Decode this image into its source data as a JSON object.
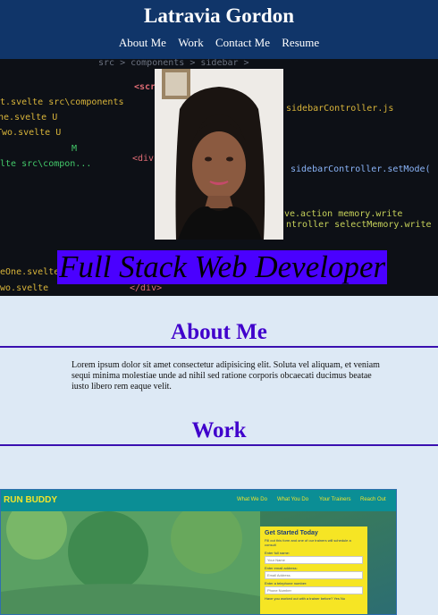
{
  "header": {
    "name": "Latravia Gordon",
    "nav": [
      "About Me",
      "Work",
      "Contact Me",
      "Resume"
    ]
  },
  "hero": {
    "tagline": "Full Stack Web Developer",
    "code_lines": [
      {
        "text": "src > components > sidebar >",
        "color": "#6b7280"
      },
      {
        "text": "<scri",
        "color": "#e06c75"
      },
      {
        "text": "ht.svelte  src\\components",
        "color": "#d8b43a"
      },
      {
        "text": "ne.svelte   U",
        "color": "#d8b43a"
      },
      {
        "text": "Two.svelte  U",
        "color": "#d8b43a"
      },
      {
        "text": "M",
        "color": "#43c96a"
      },
      {
        "text": "elte  src\\compon...",
        "color": "#43c96a"
      },
      {
        "text": "sidebarController.js",
        "color": "#d8b43a"
      },
      {
        "text": "sidebarController.setMode(",
        "color": "#8ab4f8"
      },
      {
        "text": "ve.action memory.write",
        "color": "#c6d15a"
      },
      {
        "text": "ntroller selectMemory.write",
        "color": "#c6d15a"
      },
      {
        "text": "<div",
        "color": "#e06c75"
      },
      {
        "text": "</div>",
        "color": "#e06c75"
      },
      {
        "text": "neOne.svelte",
        "color": "#d8b43a"
      },
      {
        "text": "Two.svelte",
        "color": "#d8b43a"
      }
    ]
  },
  "about": {
    "title": "About Me",
    "text": "Lorem ipsum dolor sit amet consectetur adipisicing elit. Soluta vel aliquam, et veniam sequi minima molestiae unde ad nihil sed ratione corporis obcaecati ducimus beatae iusto libero rem eaque velit."
  },
  "work": {
    "title": "Work",
    "project": {
      "brand": "RUN BUDDY",
      "nav": [
        "What We Do",
        "What You Do",
        "Your Trainers",
        "Reach Out"
      ],
      "form_title": "Get Started Today",
      "form_subtitle": "Fill out this form and one of our trainers will schedule a consult",
      "fields": [
        {
          "label": "Enter full name:",
          "placeholder": "Your Name"
        },
        {
          "label": "Enter email address:",
          "placeholder": "Email Address"
        },
        {
          "label": "Enter a telephone number:",
          "placeholder": "Phone Number"
        }
      ],
      "question": "Have you worked out with a trainer before?",
      "yes": "Yes",
      "no": "No"
    }
  },
  "colors": {
    "header_bg": "#103569",
    "page_bg": "#dde9f5",
    "accent_purple": "#4000cc",
    "tagline_bg": "#4a00ff",
    "runbuddy_teal": "#0b8e95",
    "runbuddy_yellow": "#f3e52b"
  }
}
